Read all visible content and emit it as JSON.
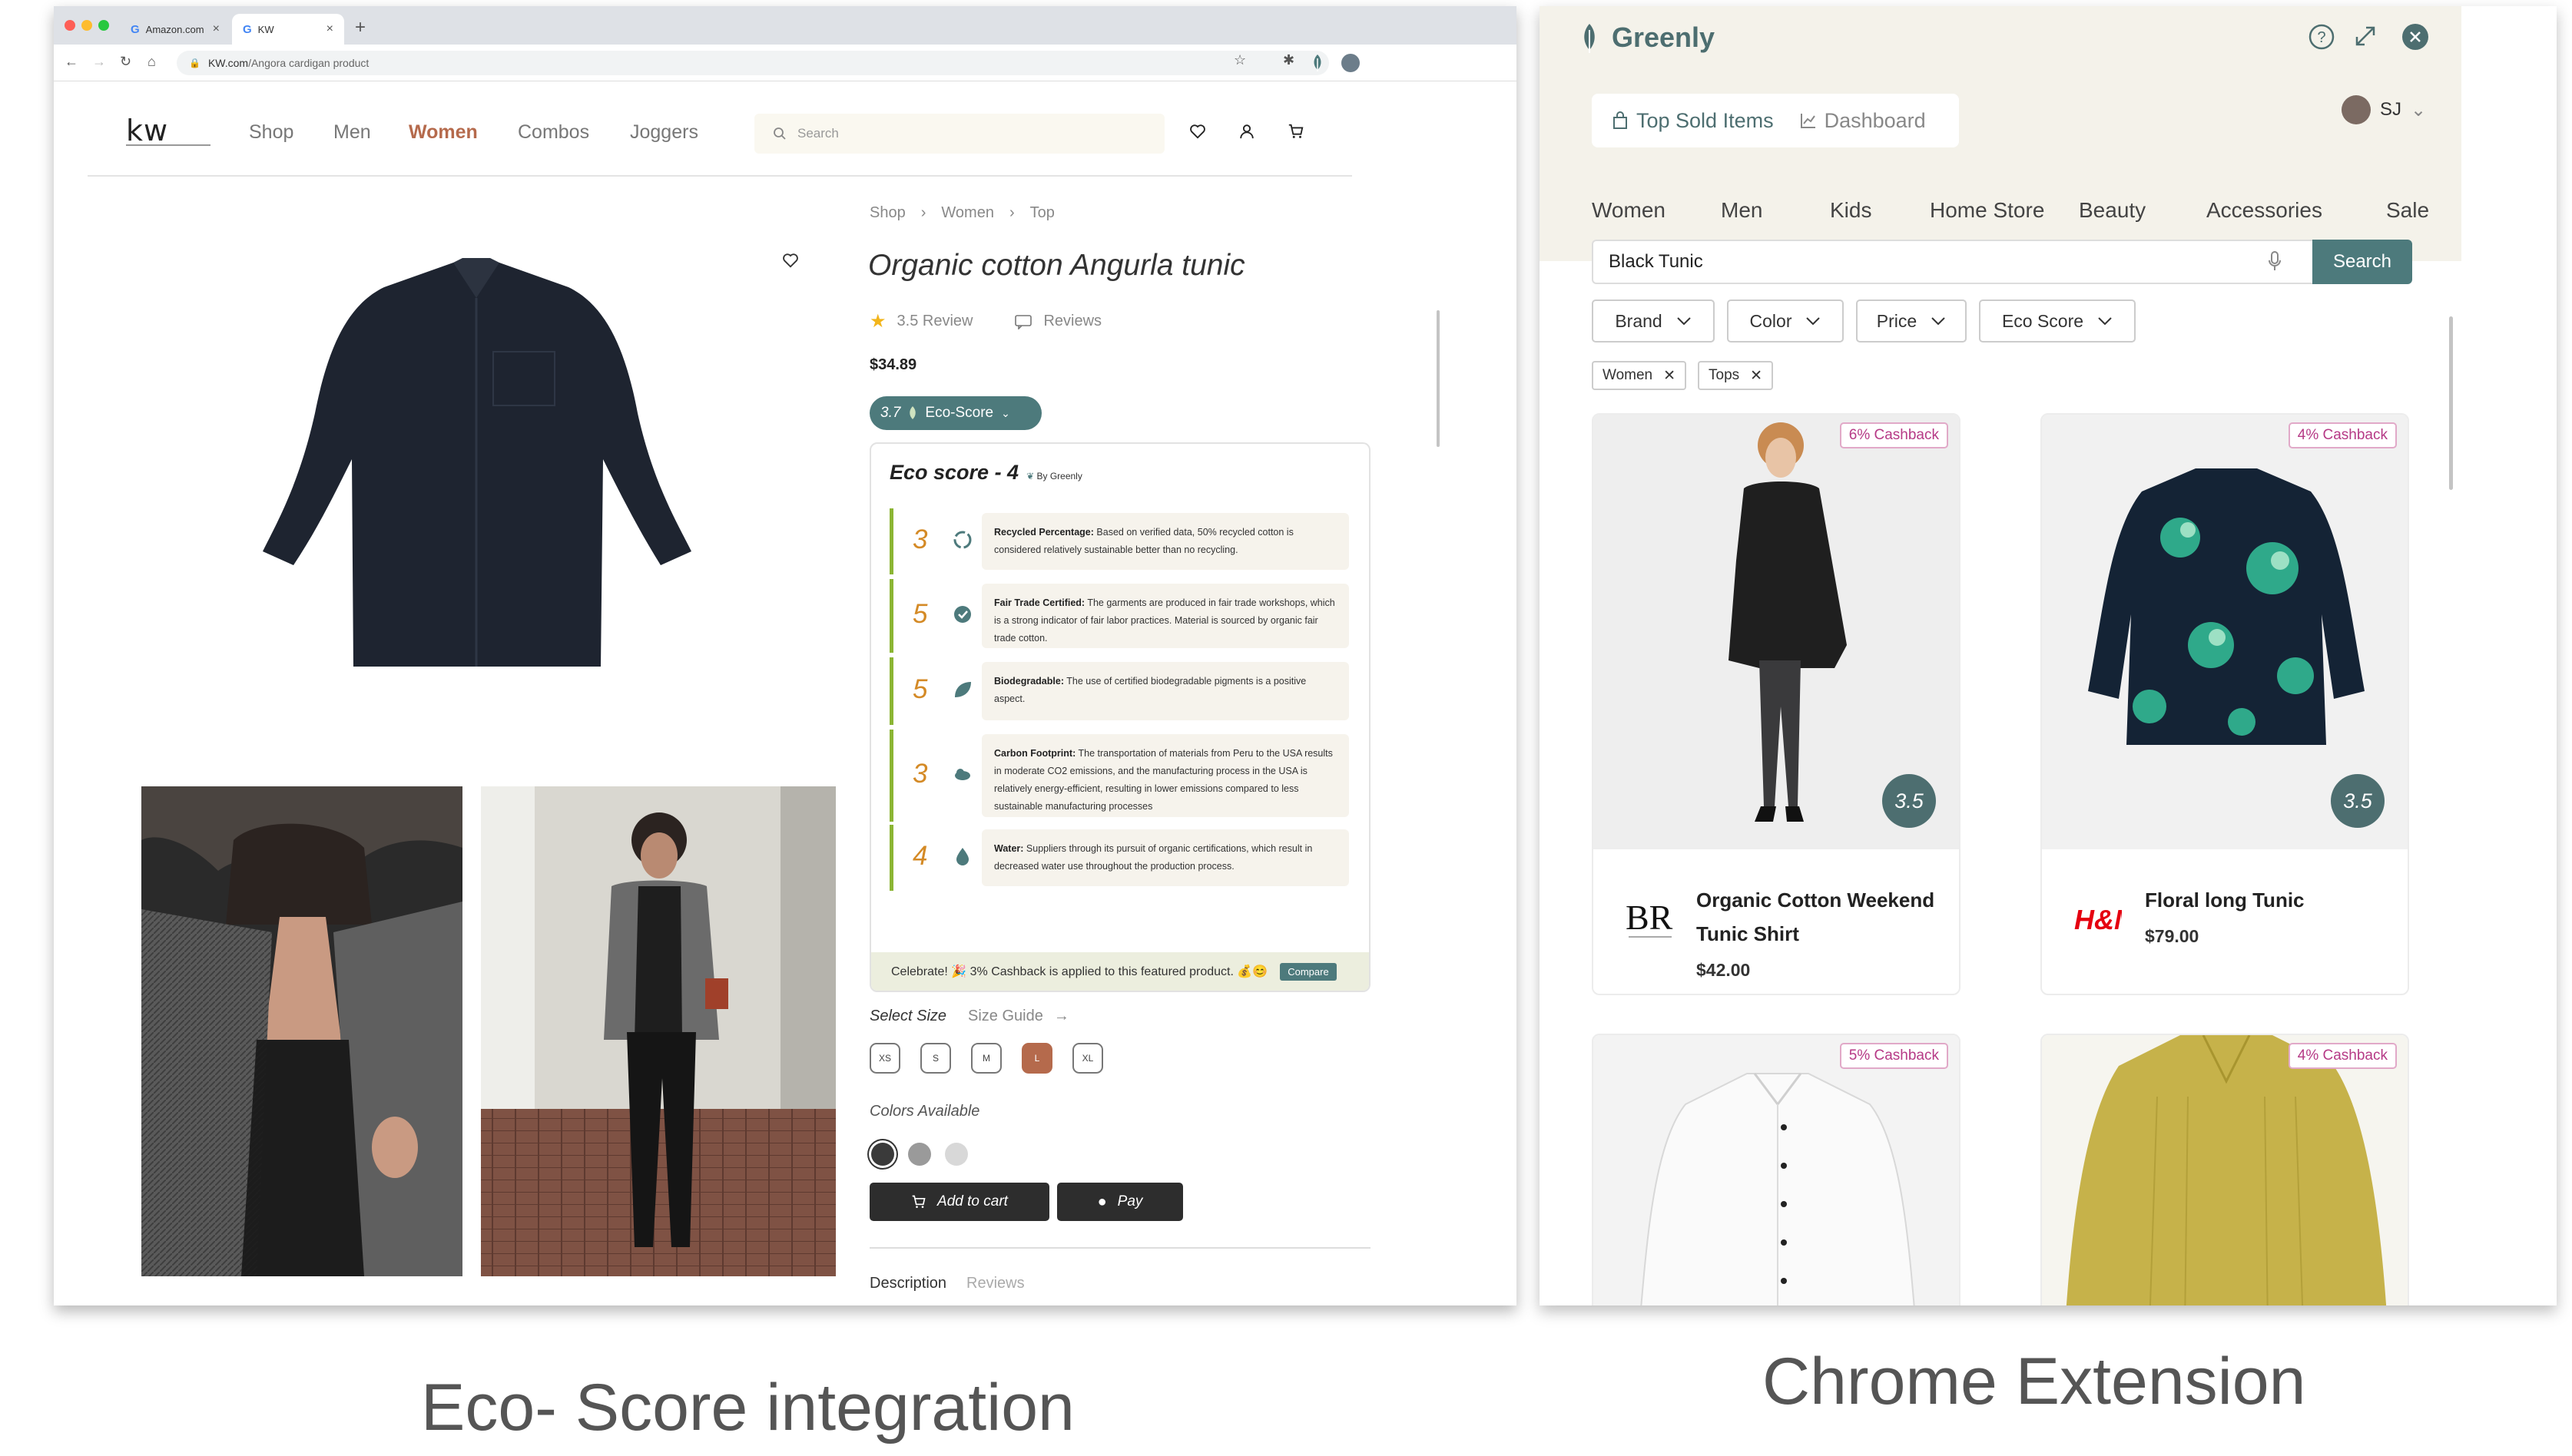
{
  "browser": {
    "tabs": [
      {
        "label": "Amazon.com"
      },
      {
        "label": "KW"
      }
    ],
    "new_tab": "+",
    "url_domain": "KW.com",
    "url_path": "/Angora cardigan product"
  },
  "site": {
    "logo": "kw",
    "nav": [
      "Shop",
      "Men",
      "Women",
      "Combos",
      "Joggers"
    ],
    "active_nav": "Women",
    "search_placeholder": "Search"
  },
  "product": {
    "breadcrumb": [
      "Shop",
      "Women",
      "Top"
    ],
    "title": "Organic cotton Angurla tunic",
    "rating_text": "3.5 Review",
    "reviews_link": "Reviews",
    "price": "$34.89",
    "eco_pill_score": "3.7",
    "eco_pill_label": "Eco-Score",
    "eco_card": {
      "title": "Eco score - 4",
      "by": "By Greenly",
      "items": [
        {
          "score": "3",
          "title": "Recycled Percentage:",
          "text": "Based on verified data, 50% recycled cotton is considered relatively sustainable better than no recycling.",
          "icon": "recycle-icon"
        },
        {
          "score": "5",
          "title": "Fair Trade Certified:",
          "text": "The garments are produced in fair trade workshops, which is a strong indicator of fair labor practices. Material is sourced by organic fair trade cotton.",
          "icon": "check-badge-icon"
        },
        {
          "score": "5",
          "title": "Biodegradable:",
          "text": "The use of certified biodegradable pigments is a positive aspect.",
          "icon": "leaf-icon"
        },
        {
          "score": "3",
          "title": "Carbon Footprint:",
          "text": "The transportation of materials from Peru to the USA results in moderate CO2 emissions, and the manufacturing process in the USA is relatively energy-efficient, resulting in lower emissions compared to less sustainable manufacturing processes",
          "icon": "cloud-icon"
        },
        {
          "score": "4",
          "title": "Water:",
          "text": "Suppliers through its pursuit of organic certifications, which result in decreased water use throughout the production process.",
          "icon": "water-drop-icon"
        }
      ],
      "celebrate": "Celebrate! 🎉 3% Cashback is applied to this featured product. 💰😊",
      "compare": "Compare"
    },
    "select_size": "Select Size",
    "size_guide": "Size Guide",
    "sizes": [
      "XS",
      "S",
      "M",
      "L",
      "XL"
    ],
    "selected_size": "L",
    "colors_label": "Colors Available",
    "colors": [
      "#3a3a3a",
      "#9a9a9a",
      "#d8d8d8"
    ],
    "add_to_cart": "Add to cart",
    "pay": "Pay",
    "desc_tabs": [
      "Description",
      "Reviews"
    ]
  },
  "extension": {
    "brand": "Greenly",
    "tabs": [
      "Top Sold Items",
      "Dashboard"
    ],
    "user": "SJ",
    "categories": [
      "Women",
      "Men",
      "Kids",
      "Home Store",
      "Beauty",
      "Accessories",
      "Sale"
    ],
    "search_value": "Black Tunic",
    "search_button": "Search",
    "filters": [
      "Brand",
      "Color",
      "Price",
      "Eco Score"
    ],
    "chips": [
      "Women",
      "Tops"
    ],
    "products": [
      {
        "cashback": "6% Cashback",
        "score": "3.5",
        "name": "Organic Cotton Weekend Tunic Shirt",
        "price": "$42.00",
        "brand": "banana-republic"
      },
      {
        "cashback": "4% Cashback",
        "score": "3.5",
        "name": "Floral long Tunic",
        "price": "$79.00",
        "brand": "hm"
      },
      {
        "cashback": "5% Cashback"
      },
      {
        "cashback": "4% Cashback"
      }
    ]
  },
  "captions": {
    "left": "Eco- Score integration",
    "right": "Chrome Extension"
  },
  "colors": {
    "teal": "#4d7a7c",
    "eco_bar": "#8bb534",
    "eco_number": "#d48a26",
    "active_nav": "#b56a4c",
    "cashback": "#b63a86"
  }
}
